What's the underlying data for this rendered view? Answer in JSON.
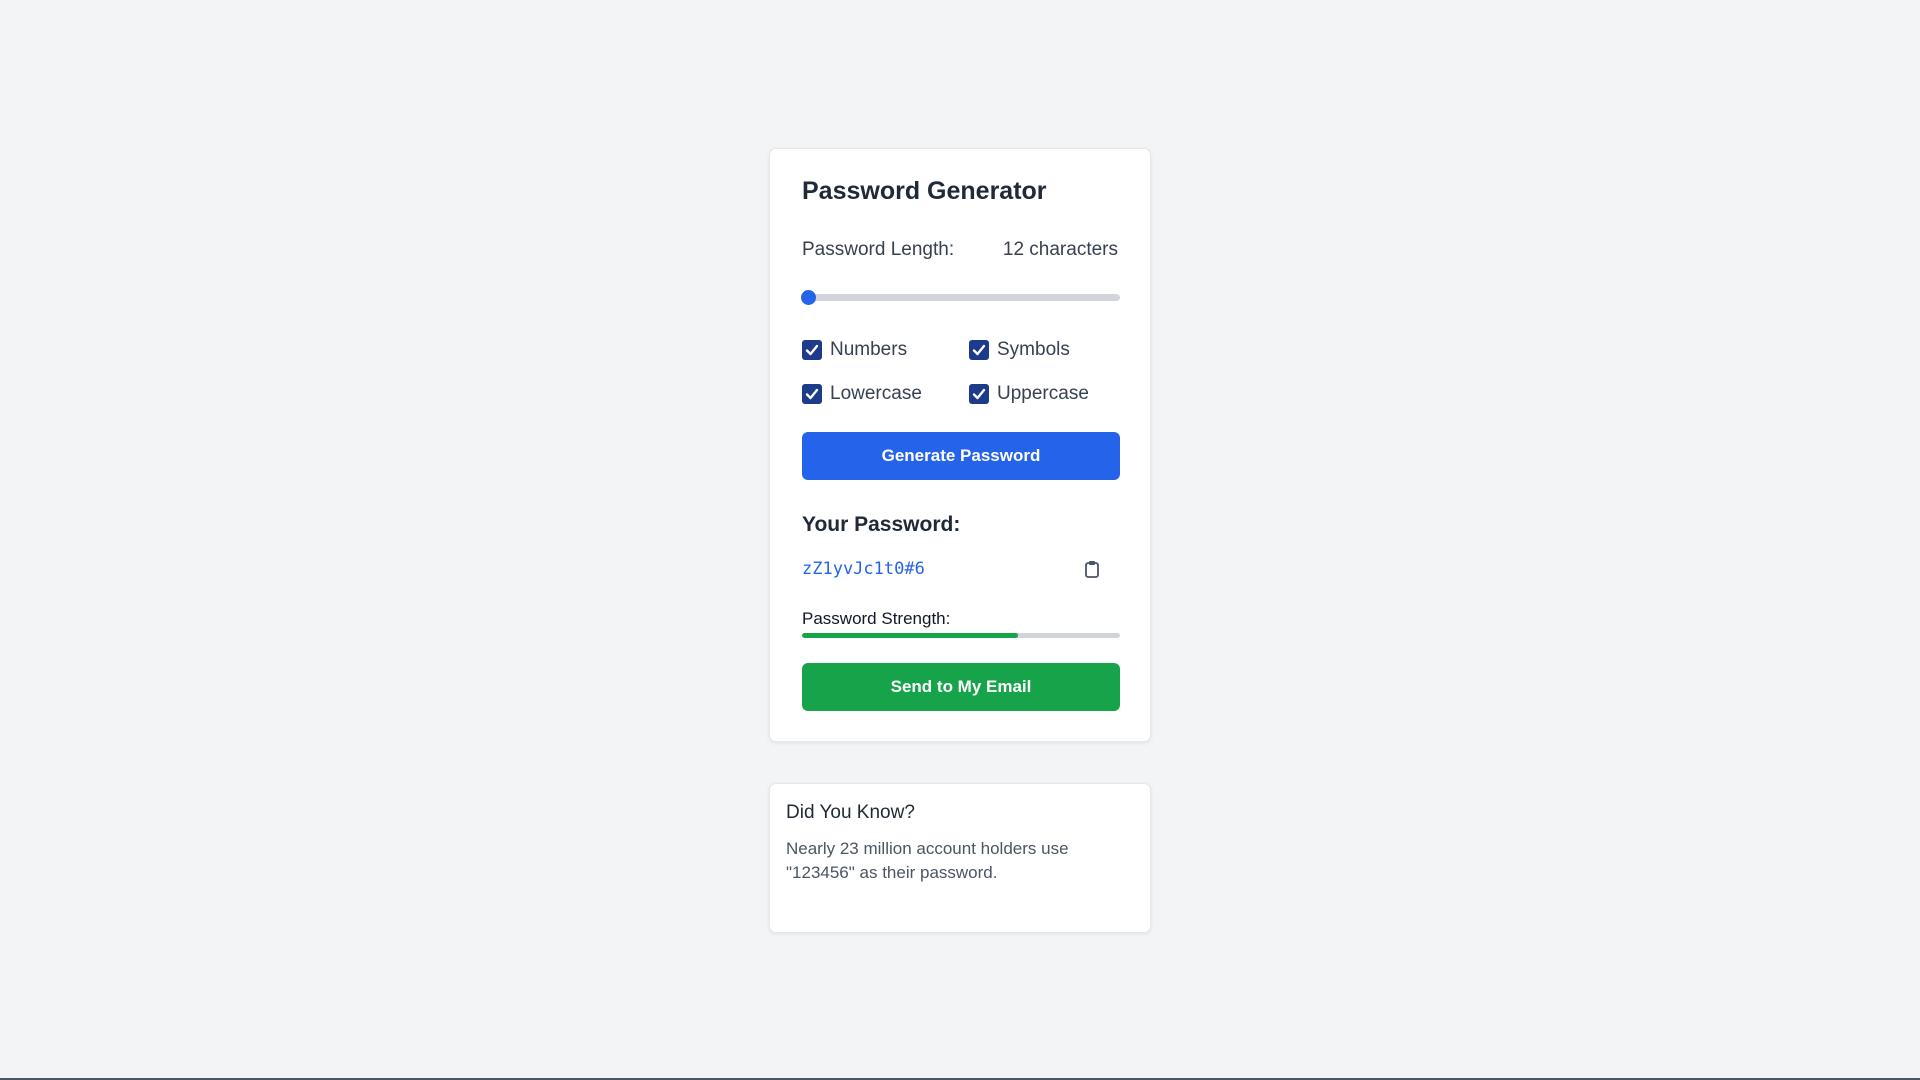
{
  "generator": {
    "title": "Password Generator",
    "length_label": "Password Length:",
    "length_value": "12 characters",
    "slider_fraction": 0.02,
    "options": [
      {
        "label": "Numbers",
        "checked": true
      },
      {
        "label": "Symbols",
        "checked": true
      },
      {
        "label": "Lowercase",
        "checked": true
      },
      {
        "label": "Uppercase",
        "checked": true
      }
    ],
    "generate_label": "Generate Password",
    "your_password_label": "Your Password:",
    "password_value": "zZ1yvJc1t0#6",
    "strength_label": "Password Strength:",
    "strength_fraction": 0.68,
    "email_label": "Send to My Email",
    "copy_icon": "clipboard-icon"
  },
  "tip": {
    "title": "Did You Know?",
    "text": "Nearly 23 million account holders use \"123456\" as their password."
  },
  "colors": {
    "accent": "#2563eb",
    "success": "#16a34a",
    "checkbox": "#1e3a8a",
    "background": "#f3f4f6"
  }
}
